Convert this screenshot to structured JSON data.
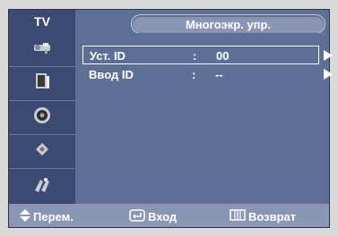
{
  "header": {
    "tv_label": "TV",
    "title": "Многоэкр. упр."
  },
  "sidebar": {
    "items": [
      {
        "icon": "picture-icon"
      },
      {
        "icon": "speaker-icon"
      },
      {
        "icon": "sound-icon"
      },
      {
        "icon": "channel-icon"
      },
      {
        "icon": "setup-icon"
      }
    ]
  },
  "menu": {
    "rows": [
      {
        "label": "Уст. ID",
        "colon": ":",
        "value": "00"
      },
      {
        "label": "Ввод ID",
        "colon": ":",
        "value": "--"
      }
    ]
  },
  "footer": {
    "move": "Перем.",
    "enter": "Вход",
    "return": "Возврат"
  },
  "colors": {
    "panel": "#5d6f95",
    "sidebar": "#3b4a70",
    "footer": "#8a96b3"
  }
}
